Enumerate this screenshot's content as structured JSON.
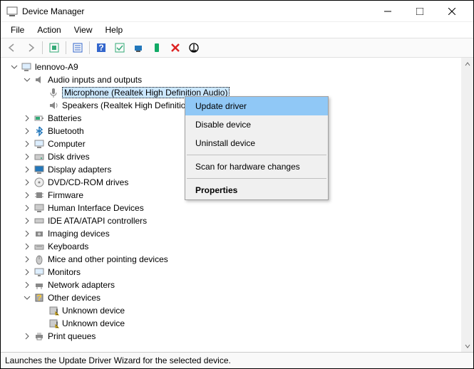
{
  "window": {
    "title": "Device Manager"
  },
  "menu": {
    "file": "File",
    "action": "Action",
    "view": "View",
    "help": "Help"
  },
  "tree": {
    "root": "lennovo-A9",
    "audio": {
      "label": "Audio inputs and outputs",
      "microphone": "Microphone (Realtek High Definition Audio)",
      "speakers": "Speakers (Realtek High Definition Audio)"
    },
    "batteries": "Batteries",
    "bluetooth": "Bluetooth",
    "computer": "Computer",
    "disk": "Disk drives",
    "display": "Display adapters",
    "dvd": "DVD/CD-ROM drives",
    "firmware": "Firmware",
    "hid": "Human Interface Devices",
    "ide": "IDE ATA/ATAPI controllers",
    "imaging": "Imaging devices",
    "keyboards": "Keyboards",
    "mice": "Mice and other pointing devices",
    "monitors": "Monitors",
    "network": "Network adapters",
    "other": {
      "label": "Other devices",
      "unknown1": "Unknown device",
      "unknown2": "Unknown device"
    },
    "print": "Print queues"
  },
  "context_menu": {
    "update": "Update driver",
    "disable": "Disable device",
    "uninstall": "Uninstall device",
    "scan": "Scan for hardware changes",
    "properties": "Properties"
  },
  "status": "Launches the Update Driver Wizard for the selected device."
}
